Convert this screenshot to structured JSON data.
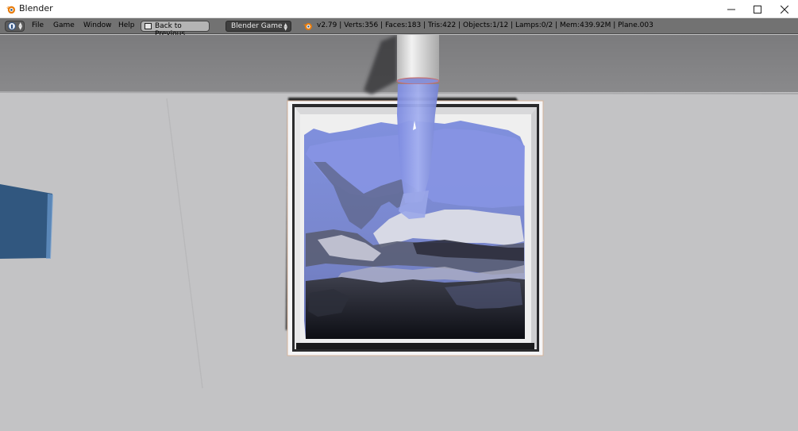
{
  "window": {
    "title": "Blender",
    "icon": "blender-logo-icon",
    "controls": [
      "minimize-icon",
      "maximize-icon",
      "close-icon"
    ]
  },
  "header": {
    "editor_type_icon": "info-icon",
    "menus": [
      "File",
      "Game",
      "Window",
      "Help"
    ],
    "back_button": "Back to Previous",
    "render_engine": "Blender Game",
    "stats": "v2.79 | Verts:356 | Faces:183 | Tris:422 | Objects:1/12 | Lamps:0/2 | Mem:439.92M | Plane.003"
  },
  "colors": {
    "header_bg": "#727272",
    "viewport_floor": "#c3c3c5",
    "water": "#7f8fd9",
    "blender_orange": "#e87d0d"
  }
}
